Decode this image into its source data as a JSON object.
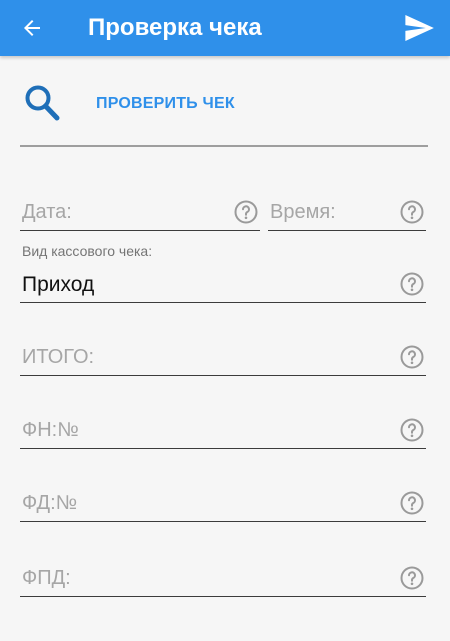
{
  "appbar": {
    "title": "Проверка чека",
    "back_icon": "arrow-left-icon",
    "send_icon": "send-icon",
    "color": "#2f90ea"
  },
  "check": {
    "button_label": "ПРОВЕРИТЬ ЧЕК",
    "icon": "search-icon",
    "accent": "#2f90ea"
  },
  "form": {
    "date_label": "Дата:",
    "time_label": "Время:",
    "receipt_type_caption": "Вид кассового чека:",
    "receipt_type_value": "Приход",
    "total_label": "ИТОГО:",
    "fn_label": "ФН:№",
    "fd_label": "ФД:№",
    "fpd_label": "ФПД:",
    "help_icon": "help-circle-icon"
  }
}
